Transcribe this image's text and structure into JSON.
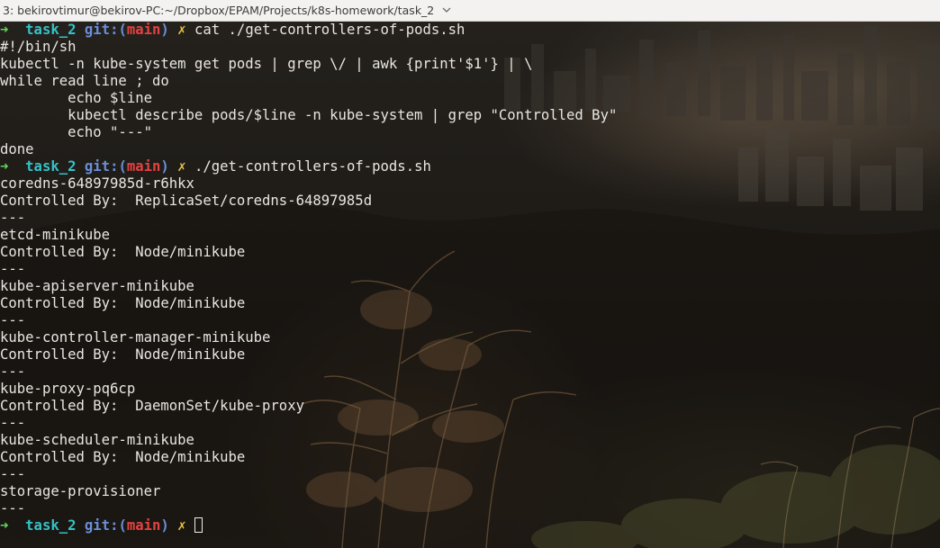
{
  "window": {
    "tab_title": "3: bekirovtimur@bekirov-PC:~/Dropbox/EPAM/Projects/k8s-homework/task_2",
    "tab_dropdown_icon": "chevron-down-icon"
  },
  "prompt": {
    "arrow": "➜",
    "dir": "task_2",
    "git_label": "git:(",
    "branch": "main",
    "git_close": ")",
    "dirty_mark": "✗"
  },
  "terminal": {
    "cmd1": "cat ./get-controllers-of-pods.sh",
    "script_lines": [
      "#!/bin/sh",
      "kubectl -n kube-system get pods | grep \\/ | awk {print'$1'} | \\",
      "while read line ; do",
      "        echo $line",
      "        kubectl describe pods/$line -n kube-system | grep \"Controlled By\"",
      "        echo \"---\"",
      "done"
    ],
    "cmd2": "./get-controllers-of-pods.sh",
    "output_lines": [
      "coredns-64897985d-r6hkx",
      "Controlled By:  ReplicaSet/coredns-64897985d",
      "---",
      "etcd-minikube",
      "Controlled By:  Node/minikube",
      "---",
      "kube-apiserver-minikube",
      "Controlled By:  Node/minikube",
      "---",
      "kube-controller-manager-minikube",
      "Controlled By:  Node/minikube",
      "---",
      "kube-proxy-pq6cp",
      "Controlled By:  DaemonSet/kube-proxy",
      "---",
      "kube-scheduler-minikube",
      "Controlled By:  Node/minikube",
      "---",
      "storage-provisioner",
      "---"
    ],
    "cmd3": ""
  },
  "colors": {
    "prompt_arrow": "#5fd75f",
    "prompt_dir": "#34c2c8",
    "prompt_git": "#6a8fd8",
    "prompt_branch": "#e44242",
    "prompt_dirty": "#e3c44b",
    "text": "#e9e6e1"
  }
}
